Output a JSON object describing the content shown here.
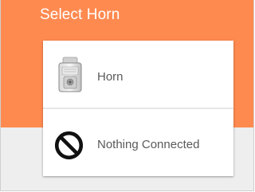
{
  "dialog": {
    "title": "Select Horn",
    "header_color": "#ff8a50"
  },
  "options": [
    {
      "label": "Horn",
      "icon": "horn-device-icon"
    },
    {
      "label": "Nothing Connected",
      "icon": "prohibited-icon"
    }
  ]
}
